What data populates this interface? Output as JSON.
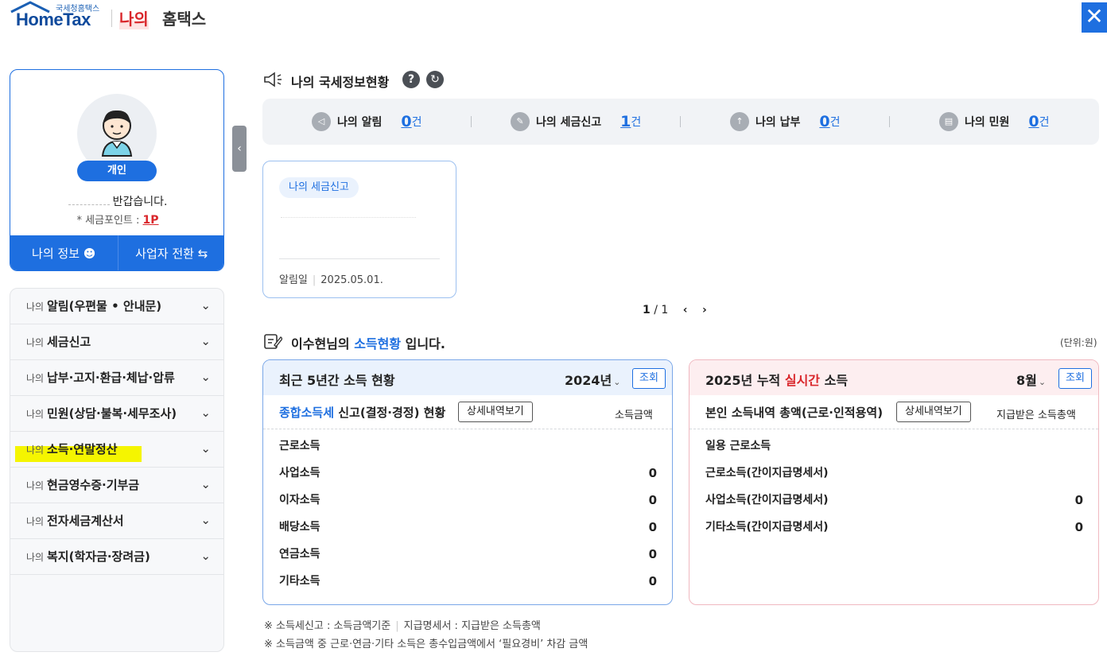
{
  "header": {
    "logo_small": "국세청홈택스",
    "logo_main": "HomeTax",
    "title_red": "나의",
    "title_black": "홈택스",
    "close_icon": "close-icon"
  },
  "profile": {
    "badge": "개인",
    "greeting": "반갑습니다.",
    "points_label": "* 세금포인트 :",
    "points_value": "1P",
    "btn_info": "나의 정보",
    "btn_switch": "사업자 전환"
  },
  "menu": {
    "prefix": "나의",
    "items": [
      {
        "label": "알림(우편물 • 안내문)"
      },
      {
        "label": "세금신고"
      },
      {
        "label": "납부·고지·환급·체납·압류"
      },
      {
        "label": "민원(상담·불복·세무조사)"
      },
      {
        "label": "소득·연말정산"
      },
      {
        "label": "현금영수증·기부금"
      },
      {
        "label": "전자세금계산서"
      },
      {
        "label": "복지(학자금·장려금)"
      }
    ]
  },
  "main": {
    "section1_title": "나의 국세정보현황",
    "help_icon": "?",
    "summary": [
      {
        "label": "나의 알림",
        "count": "0",
        "unit": "건"
      },
      {
        "label": "나의 세금신고",
        "count": "1",
        "unit": "건"
      },
      {
        "label": "나의 납부",
        "count": "0",
        "unit": "건"
      },
      {
        "label": "나의 민원",
        "count": "0",
        "unit": "건"
      }
    ],
    "notice": {
      "tag": "나의 세금신고",
      "date_label": "알림일",
      "date": "2025.05.01."
    },
    "pager": {
      "current": "1",
      "total": "1"
    },
    "section2_title_pre": "이수현님의",
    "section2_title_hl": "소득현황",
    "section2_title_post": "입니다.",
    "unit_note": "(단위:원)",
    "left_box": {
      "title": "최근 5년간 소득 현황",
      "year": "2024년",
      "lookup": "조회",
      "sub_blue": "종합소득세",
      "sub_rest": "신고(결정·경정) 현황",
      "detail_btn": "상세내역보기",
      "col_head": "소득금액",
      "rows": [
        {
          "label": "근로소득",
          "value": ""
        },
        {
          "label": "사업소득",
          "value": "0"
        },
        {
          "label": "이자소득",
          "value": "0"
        },
        {
          "label": "배당소득",
          "value": "0"
        },
        {
          "label": "연금소득",
          "value": "0"
        },
        {
          "label": "기타소득",
          "value": "0"
        }
      ]
    },
    "right_box": {
      "title_pre": "2025년 누적",
      "title_red": "실시간",
      "title_post": "소득",
      "month": "8월",
      "lookup": "조회",
      "sub": "본인 소득내역 총액(근로·인적용역)",
      "detail_btn": "상세내역보기",
      "col_head": "지급받은 소득총액",
      "rows": [
        {
          "label": "일용 근로소득",
          "value": ""
        },
        {
          "label": "근로소득(간이지급명세서)",
          "value": ""
        },
        {
          "label": "사업소득(간이지급명세서)",
          "value": "0"
        },
        {
          "label": "기타소득(간이지급명세서)",
          "value": "0"
        }
      ]
    },
    "footnotes": {
      "line1_a": "※ 소득세신고 : 소득금액기준",
      "line1_b": "지급명세서 : 지급받은 소득총액",
      "line2": "※ 소득금액 중 근로·연금·기타 소득은 총수입금액에서 ‘필요경비’ 차감 금액"
    }
  }
}
